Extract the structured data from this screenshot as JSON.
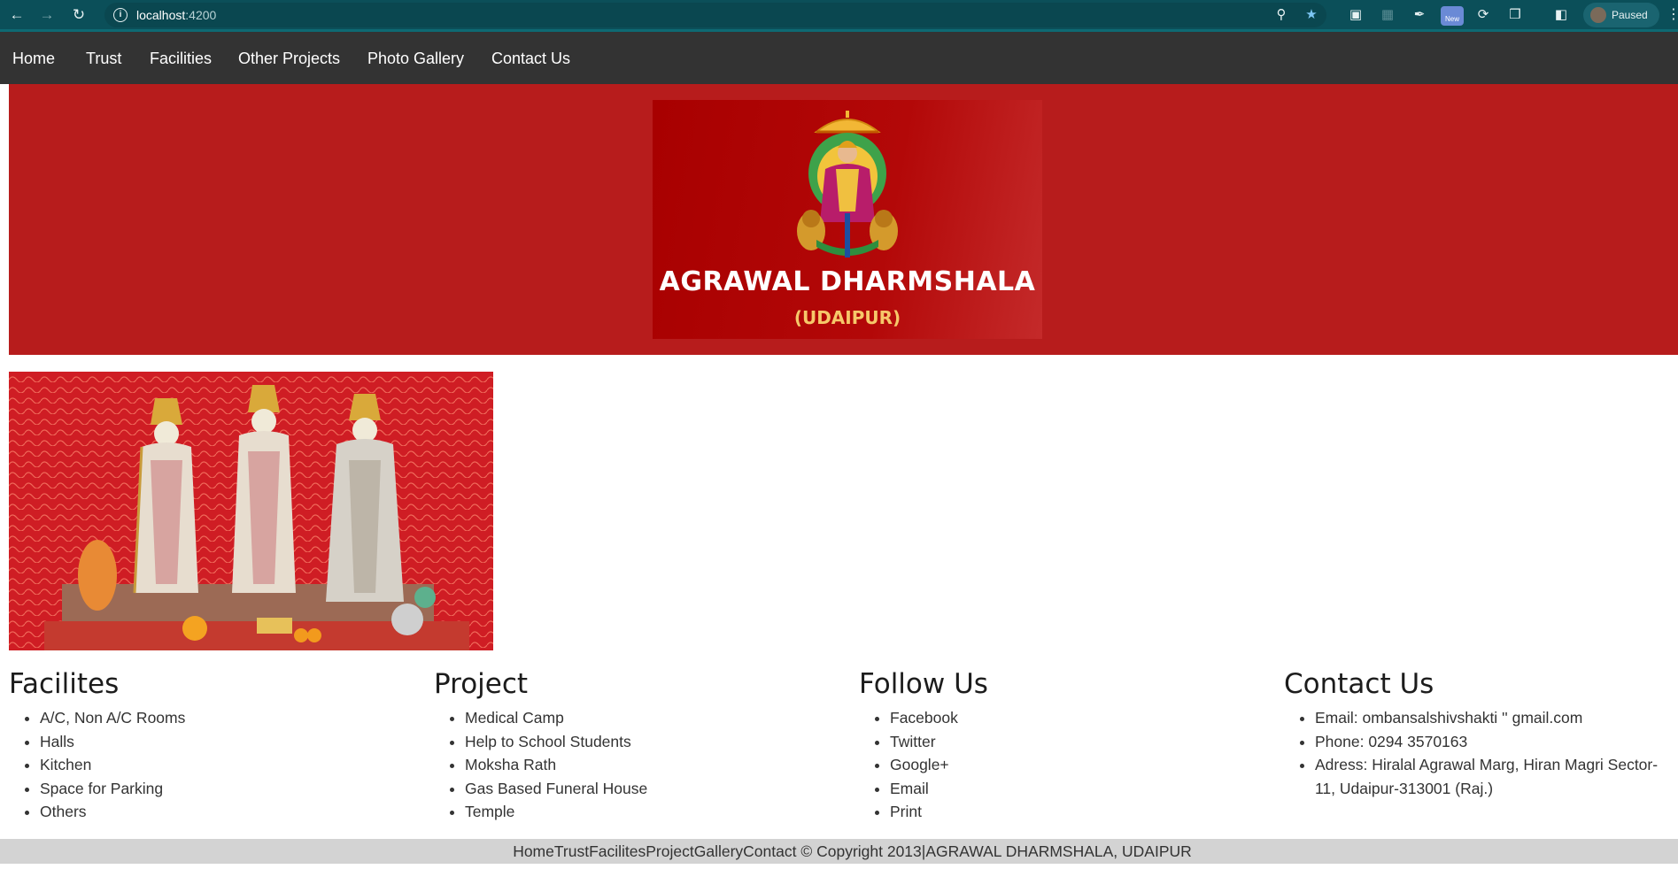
{
  "browser": {
    "url_host": "localhost",
    "url_port": ":4200",
    "profile_status": "Paused",
    "new_badge": "New"
  },
  "nav": {
    "items": [
      "Home",
      "Trust",
      "Facilities",
      "Other Projects",
      "Photo Gallery",
      "Contact Us"
    ]
  },
  "banner": {
    "title": "AGRAWAL DHARMSHALA",
    "subtitle": "(UDAIPUR)"
  },
  "footer": {
    "facilities": {
      "heading": "Facilites",
      "items": [
        "A/C, Non A/C Rooms",
        "Halls",
        "Kitchen",
        "Space for Parking",
        "Others"
      ]
    },
    "project": {
      "heading": "Project",
      "items": [
        "Medical Camp",
        "Help to School Students",
        "Moksha Rath",
        "Gas Based Funeral House",
        "Temple"
      ]
    },
    "follow": {
      "heading": "Follow Us",
      "items": [
        "Facebook",
        "Twitter",
        "Google+",
        "Email",
        "Print"
      ]
    },
    "contact": {
      "heading": "Contact Us",
      "items": [
        "Email: ombansalshivshakti '' gmail.com",
        "Phone: 0294 3570163",
        "Adress: Hiralal Agrawal Marg, Hiran Magri Sector-11, Udaipur-313001 (Raj.)"
      ]
    }
  },
  "copyright": "HomeTrustFacilitesProjectGalleryContact © Copyright 2013|AGRAWAL DHARMSHALA, UDAIPUR",
  "colors": {
    "navbar": "#333333",
    "banner": "#b71c1c",
    "logo_bg": "#a80000",
    "footer_bar": "#d3d3d3",
    "chrome": "#0b4f59"
  }
}
